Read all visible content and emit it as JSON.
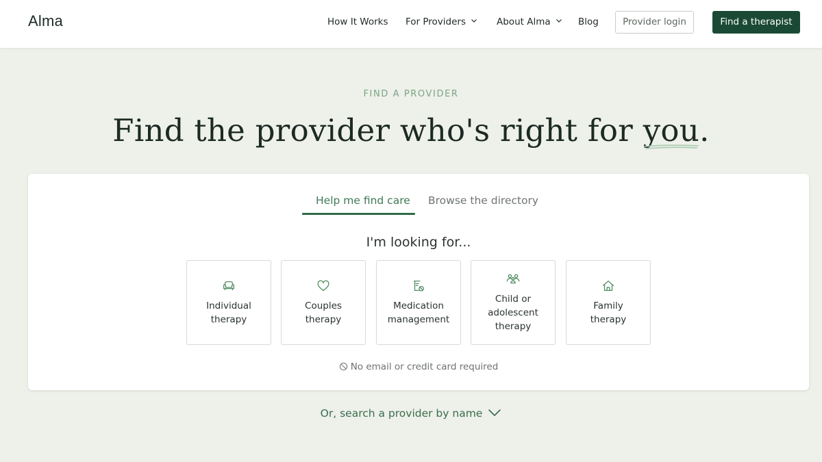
{
  "header": {
    "logo": "Alma",
    "nav": {
      "how_it_works": "How It Works",
      "for_providers": "For Providers",
      "about_alma": "About Alma",
      "blog": "Blog"
    },
    "provider_login": "Provider login",
    "find_therapist": "Find a therapist"
  },
  "hero": {
    "eyebrow": "FIND A PROVIDER",
    "title_main": "Find the provider who's right for ",
    "title_emph": "you",
    "title_end": "."
  },
  "card": {
    "tabs": [
      {
        "label": "Help me find care",
        "active": true
      },
      {
        "label": "Browse the directory",
        "active": false
      }
    ],
    "prompt": "I'm looking for...",
    "options": [
      {
        "label_line1": "Individual",
        "label_line2": "therapy",
        "icon": "couch-icon"
      },
      {
        "label_line1": "Couples",
        "label_line2": "therapy",
        "icon": "heart-icon"
      },
      {
        "label_line1": "Medication",
        "label_line2": "management",
        "icon": "prescription-icon"
      },
      {
        "label_line1": "Child or",
        "label_line2": "adolescent",
        "label_line3": "therapy",
        "icon": "family-group-icon"
      },
      {
        "label_line1": "Family",
        "label_line2": "therapy",
        "icon": "house-icon"
      }
    ],
    "note": "No email or credit card required"
  },
  "search_by_name": "Or, search a provider by name",
  "colors": {
    "accent": "#1a4a35",
    "tab_active": "#3f7a55",
    "background": "#eef0ea",
    "eyebrow": "#7aa584"
  }
}
